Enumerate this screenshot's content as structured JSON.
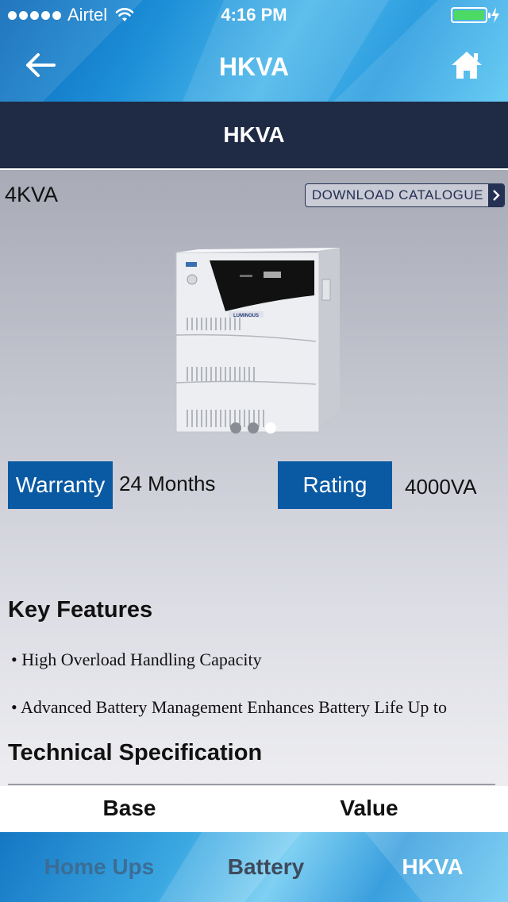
{
  "status_bar": {
    "carrier": "Airtel",
    "time": "4:16 PM",
    "icons": [
      "signal-dots-icon",
      "wifi-icon",
      "battery-icon",
      "charging-bolt-icon"
    ]
  },
  "nav": {
    "title": "HKVA",
    "back_icon": "back-arrow-icon",
    "home_icon": "home-icon"
  },
  "section": {
    "title": "HKVA"
  },
  "product": {
    "model": "4KVA",
    "catalogue_label": "DOWNLOAD CATALOGUE",
    "image_brand": "LUMINOUS",
    "slider": {
      "total": 3,
      "active_index": 2
    }
  },
  "specs": {
    "warranty_label": "Warranty",
    "warranty_value": "24 Months",
    "rating_label": "Rating",
    "rating_value": "4000VA"
  },
  "features": {
    "title": "Key Features",
    "items": [
      "• High Overload Handling Capacity",
      "• Advanced Battery Management Enhances Battery Life Up to"
    ]
  },
  "technical": {
    "title": "Technical Specification",
    "columns": [
      "Base",
      "Value"
    ]
  },
  "tabs": [
    {
      "label": "Home Ups",
      "active": false
    },
    {
      "label": "Battery",
      "active": false
    },
    {
      "label": "HKVA",
      "active": true
    }
  ],
  "colors": {
    "header_dark": "#1f2a44",
    "badge_blue": "#0a5aa3",
    "accent_light_blue": "#3ba8e2",
    "battery_green": "#4cd964"
  }
}
